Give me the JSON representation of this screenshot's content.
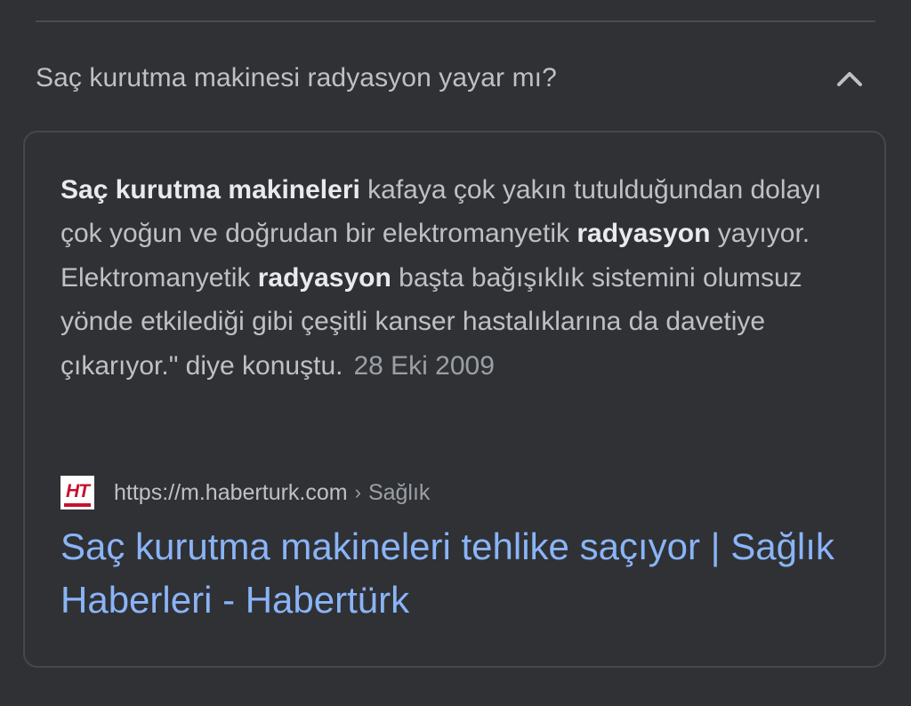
{
  "question": {
    "text": "Saç kurutma makinesi radyasyon yayar mı?",
    "expand_icon": "chevron-up-icon"
  },
  "snippet": {
    "segments": [
      {
        "text": "Saç kurutma makineleri",
        "bold": true
      },
      {
        "text": " kafaya çok yakın tutulduğundan dolayı çok yoğun ve doğrudan bir elektromanyetik ",
        "bold": false
      },
      {
        "text": "radyasyon",
        "bold": true
      },
      {
        "text": " yayıyor. Elektromanyetik ",
        "bold": false
      },
      {
        "text": "radyasyon",
        "bold": true
      },
      {
        "text": " başta bağışıklık sistemini olumsuz yönde etkilediği gibi çeşitli kanser hastalıklarına da davetiye çıkarıyor.\" diye konuştu.",
        "bold": false
      }
    ],
    "date": "28 Eki 2009"
  },
  "source": {
    "favicon_text": "HT",
    "url": "https://m.haberturk.com",
    "separator": "›",
    "breadcrumb": "Sağlık"
  },
  "result": {
    "title": "Saç kurutma makineleri tehlike saçıyor | Sağlık Haberleri - Habertürk"
  },
  "colors": {
    "background": "#303134",
    "text": "#bdc1c6",
    "bold_text": "#e8eaed",
    "muted": "#9aa0a6",
    "link": "#8ab4f8",
    "favicon_red": "#c8102e"
  }
}
